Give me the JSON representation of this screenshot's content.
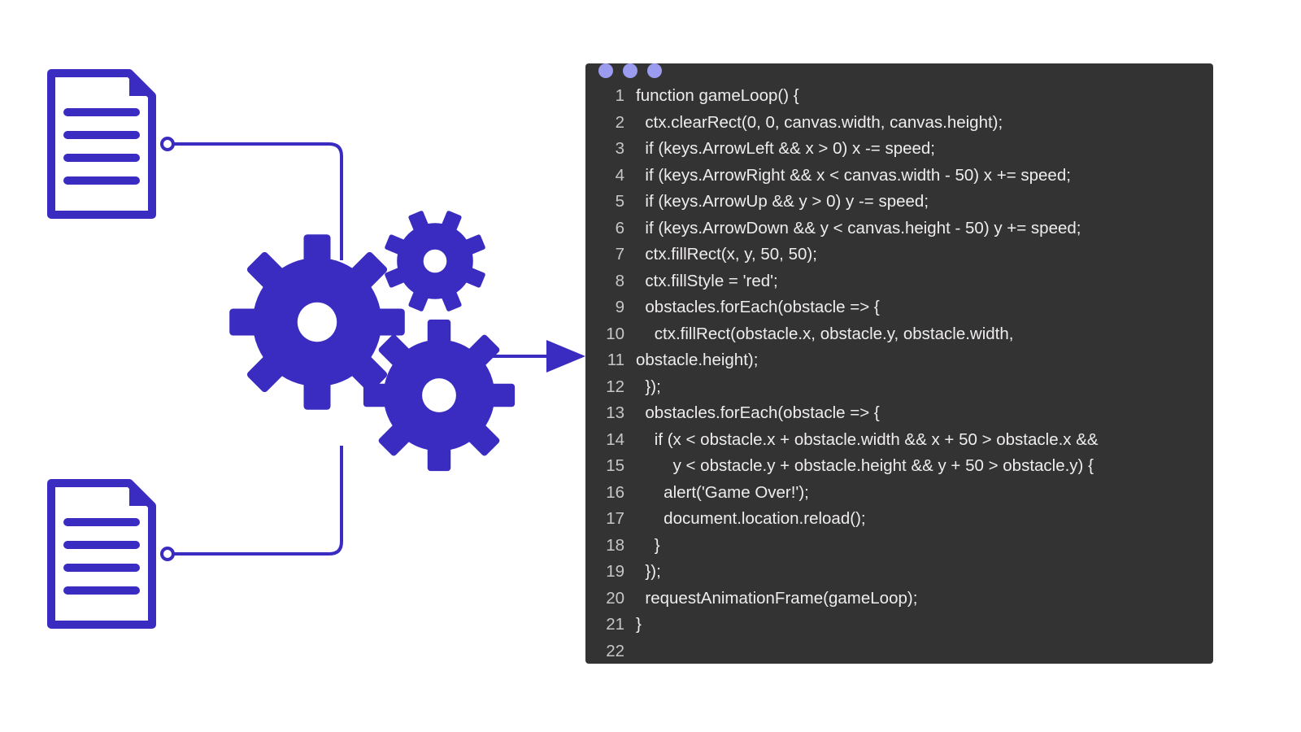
{
  "colors": {
    "accent": "#3a2cc0",
    "accent_light": "#9b9bf0",
    "editor_bg": "#333333",
    "editor_fg": "#efecec"
  },
  "code": {
    "lines": [
      "function gameLoop() {",
      "  ctx.clearRect(0, 0, canvas.width, canvas.height);",
      "  if (keys.ArrowLeft && x > 0) x -= speed;",
      "  if (keys.ArrowRight && x < canvas.width - 50) x += speed;",
      "  if (keys.ArrowUp && y > 0) y -= speed;",
      "  if (keys.ArrowDown && y < canvas.height - 50) y += speed;",
      "  ctx.fillRect(x, y, 50, 50);",
      "  ctx.fillStyle = 'red';",
      "  obstacles.forEach(obstacle => {",
      "    ctx.fillRect(obstacle.x, obstacle.y, obstacle.width,",
      "obstacle.height);",
      "  });",
      "  obstacles.forEach(obstacle => {",
      "    if (x < obstacle.x + obstacle.width && x + 50 > obstacle.x &&",
      "        y < obstacle.y + obstacle.height && y + 50 > obstacle.y) {",
      "      alert('Game Over!');",
      "      document.location.reload();",
      "    }",
      "  });",
      "  requestAnimationFrame(gameLoop);",
      "}",
      ""
    ]
  }
}
